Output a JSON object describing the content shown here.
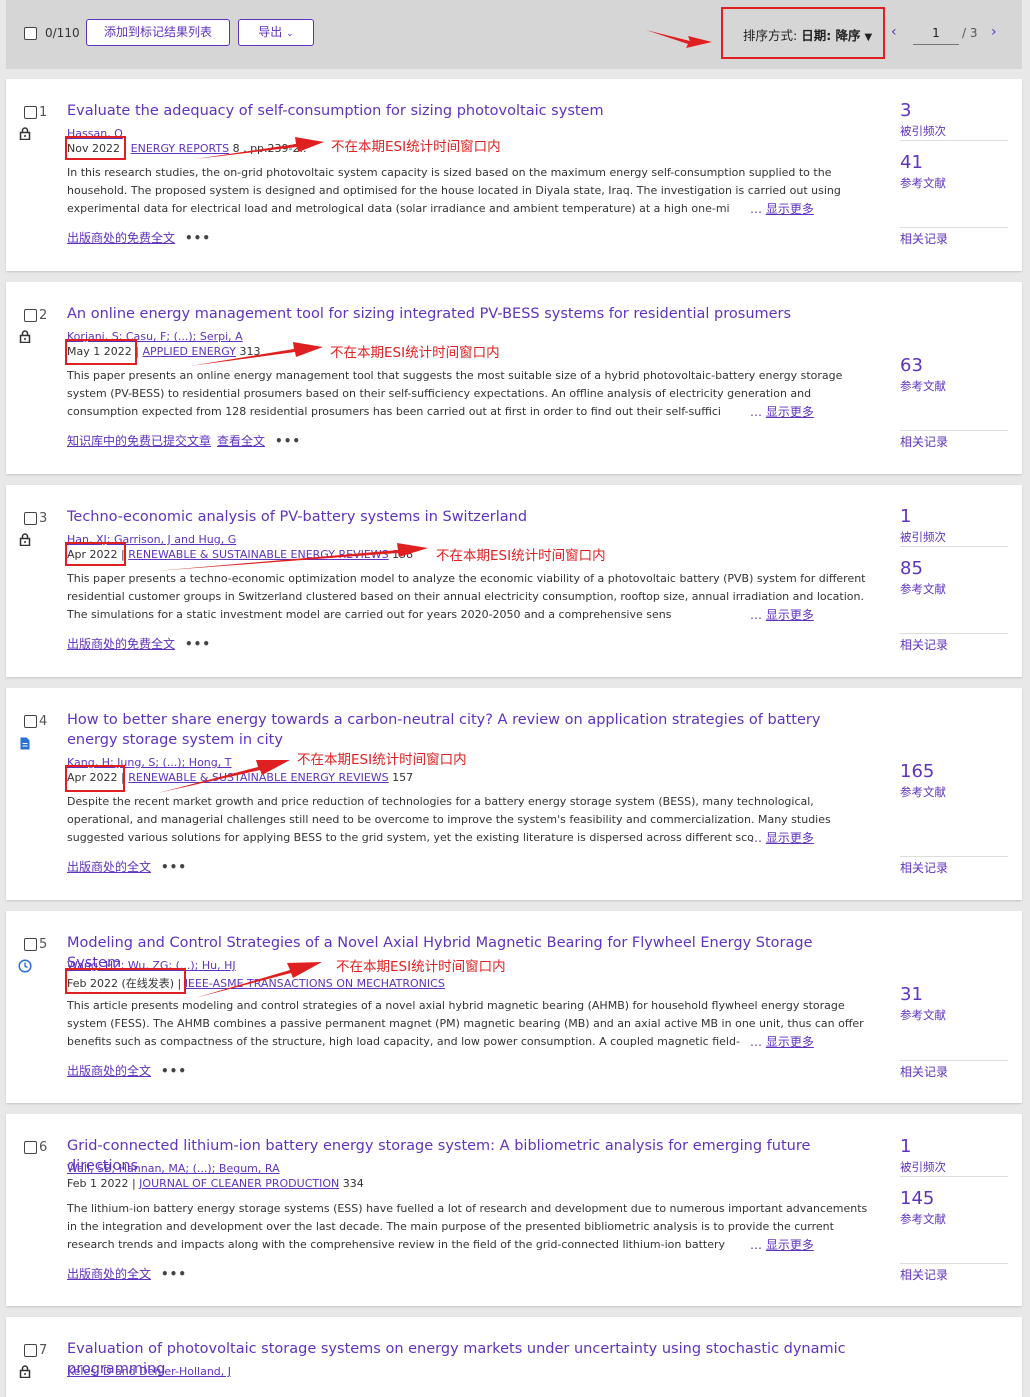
{
  "toolbar": {
    "count": "0/110",
    "add_button": "添加到标记结果列表",
    "export_button": "导出",
    "sort_label": "排序方式: ",
    "sort_value": "日期: 降序",
    "page_current": "1",
    "page_total": "/ 3"
  },
  "annotation_text": "不在本期ESI统计时间窗口内",
  "more_label": "显示更多",
  "related_label": "相关记录",
  "cite_label": "被引频次",
  "ref_label": "参考文献",
  "records": [
    {
      "index": "1",
      "title": "Evaluate the adequacy of self-consumption for sizing photovoltaic system",
      "authors": "Hassan, Q",
      "date": "Nov 2022",
      "journal": "ENERGY REPORTS",
      "journal_suffix": " 8 , pp.239-2..",
      "abstract": "In this research studies, the on-grid photovoltaic system capacity is sized based on the maximum energy self-consumption supplied to the household. The proposed system is designed and optimised for the house located in Diyala state, Iraq. The investigation is carried out using experimental data for electrical load and metrological data (solar irradiance and ambient temperature) at a high one-mi",
      "link1": "出版商处的免费全文",
      "link2": "",
      "citations": "3",
      "references": "41"
    },
    {
      "index": "2",
      "title": "An online energy management tool for sizing integrated PV-BESS systems for residential prosumers",
      "authors": "Korjani, S; Casu, F; (...); Serpi, A",
      "date": "May 1 2022",
      "journal": "APPLIED ENERGY",
      "journal_suffix": " 313",
      "abstract": "This paper presents an online energy management tool that suggests the most suitable size of a hybrid photovoltaic-battery energy storage system (PV-BESS) to residential prosumers based on their self-sufficiency expectations. An offline analysis of electricity generation and consumption expected from 128 residential prosumers has been carried out at first in order to find out their self-suffici",
      "link1": "知识库中的免费已提交文章",
      "link2": "查看全文",
      "citations": "",
      "references": "63"
    },
    {
      "index": "3",
      "title": "Techno-economic analysis of PV-battery systems in Switzerland",
      "authors": "Han, XJ; Garrison, J and Hug, G",
      "date": "Apr 2022",
      "journal": "RENEWABLE & SUSTAINABLE ENERGY REVIEWS",
      "journal_suffix": " 158",
      "abstract": "This paper presents a techno-economic optimization model to analyze the economic viability of a photovoltaic battery (PVB) system for different residential customer groups in Switzerland clustered based on their annual electricity consumption, rooftop size, annual irradiation and location. The simulations for a static investment model are carried out for years 2020-2050 and a comprehensive sens",
      "link1": "出版商处的免费全文",
      "link2": "",
      "citations": "1",
      "references": "85"
    },
    {
      "index": "4",
      "title": "How to better share energy towards a carbon-neutral city? A review on application strategies of battery energy storage system in city",
      "authors": "Kang, H; Jung, S; (...); Hong, T",
      "date": "Apr 2022",
      "journal": "RENEWABLE & SUSTAINABLE ENERGY REVIEWS",
      "journal_suffix": " 157",
      "abstract": "Despite the recent market growth and price reduction of technologies for a battery energy storage system (BESS), many technological, operational, and managerial challenges still need to be overcome to improve the system's feasibility and commercialization. Many studies suggested various solutions for applying BESS to the grid system, yet the existing literature is dispersed across different sco",
      "link1": "出版商处的全文",
      "link2": "",
      "citations": "",
      "references": "165"
    },
    {
      "index": "5",
      "title": "Modeling and Control Strategies of a Novel Axial Hybrid Magnetic Bearing for Flywheel Energy Storage System",
      "authors": "Wang, HZ; Wu, ZG; (...); Hu, HJ",
      "date": "Feb 2022 (在线发表)",
      "journal": "IEEE-ASME TRANSACTIONS ON MECHATRONICS",
      "journal_suffix": "",
      "abstract": "This article presents modeling and control strategies of a novel axial hybrid magnetic bearing (AHMB) for household flywheel energy storage system (FESS). The AHMB combines a passive permanent magnet (PM) magnetic bearing (MB) and an axial active MB in one unit, thus can offer benefits such as compactness of the structure, high load capacity, and low power consumption. A coupled magnetic field-",
      "link1": "出版商处的全文",
      "link2": "",
      "citations": "",
      "references": "31"
    },
    {
      "index": "6",
      "title": "Grid-connected lithium-ion battery energy storage system: A bibliometric analysis for emerging future directions",
      "authors": "Wali, SB; Hannan, MA; (...); Begum, RA",
      "date": "Feb 1 2022",
      "journal": "JOURNAL OF CLEANER PRODUCTION",
      "journal_suffix": " 334",
      "abstract": "The lithium-ion battery energy storage systems (ESS) have fuelled a lot of research and development due to numerous important advancements in the integration and development over the last decade. The main purpose of the presented bibliometric analysis is to provide the current research trends and impacts along with the comprehensive review in the field of the grid-connected lithium-ion battery",
      "link1": "出版商处的全文",
      "link2": "",
      "citations": "1",
      "references": "145"
    },
    {
      "index": "7",
      "title": "Evaluation of photovoltaic storage systems on energy markets under uncertainty using stochastic dynamic programming",
      "authors": "Keles, D and Dehler-Holland, J"
    }
  ]
}
